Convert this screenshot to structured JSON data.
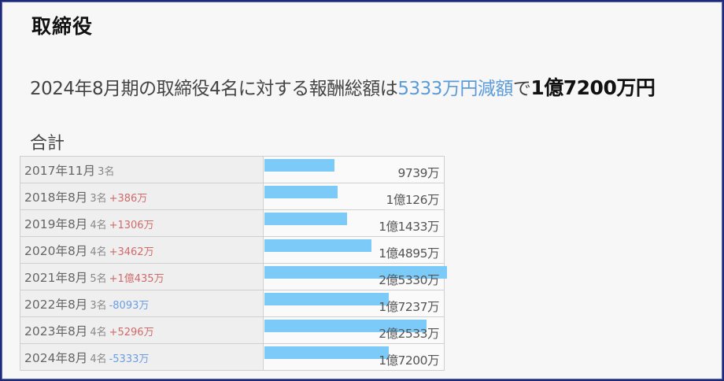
{
  "page": {
    "title": "取締役",
    "summary_prefix": "2024年8月期の取締役4名に対する報酬総額は",
    "summary_change": "5333万円減額",
    "summary_mid": "で",
    "summary_total": "1億7200万円",
    "section_label": "合計"
  },
  "colors": {
    "bar": "#7ccaf8",
    "increase": "#d06a6a",
    "decrease": "#6b9ee0",
    "highlight": "#5b9bd8"
  },
  "chart_data": {
    "type": "bar",
    "orientation": "horizontal",
    "xlim": [
      0,
      25330
    ],
    "unit": "万円",
    "rows": [
      {
        "period": "2017年11月",
        "count": "3名",
        "change": "",
        "direction": "",
        "value": 9739,
        "amount_label": "9739万"
      },
      {
        "period": "2018年8月",
        "count": "3名",
        "change": "+386万",
        "direction": "up",
        "value": 10126,
        "amount_label": "1億126万"
      },
      {
        "period": "2019年8月",
        "count": "4名",
        "change": "+1306万",
        "direction": "up",
        "value": 11433,
        "amount_label": "1億1433万"
      },
      {
        "period": "2020年8月",
        "count": "4名",
        "change": "+3462万",
        "direction": "up",
        "value": 14895,
        "amount_label": "1億4895万"
      },
      {
        "period": "2021年8月",
        "count": "5名",
        "change": "+1億435万",
        "direction": "up",
        "value": 25330,
        "amount_label": "2億5330万"
      },
      {
        "period": "2022年8月",
        "count": "3名",
        "change": "-8093万",
        "direction": "down",
        "value": 17237,
        "amount_label": "1億7237万"
      },
      {
        "period": "2023年8月",
        "count": "4名",
        "change": "+5296万",
        "direction": "up",
        "value": 22533,
        "amount_label": "2億2533万"
      },
      {
        "period": "2024年8月",
        "count": "4名",
        "change": "-5333万",
        "direction": "down",
        "value": 17200,
        "amount_label": "1億7200万"
      }
    ]
  }
}
